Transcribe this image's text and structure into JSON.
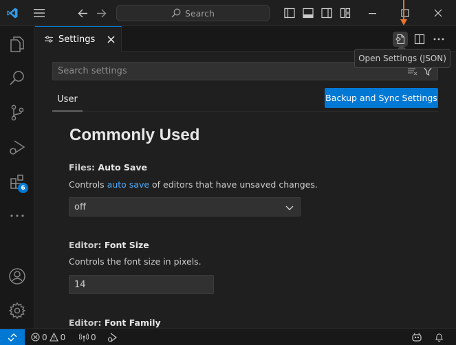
{
  "titlebar": {
    "search_label": "Search"
  },
  "activitybar": {
    "extensions_badge": "6"
  },
  "tabs": [
    {
      "label": "Settings",
      "icon": "settings-sliders-icon"
    }
  ],
  "tooltip": {
    "text": "Open Settings (JSON)"
  },
  "settings": {
    "search_placeholder": "Search settings",
    "scope_tab": "User",
    "sync_button": "Backup and Sync Settings",
    "section_title": "Commonly Used",
    "items": [
      {
        "category": "Files: ",
        "name": "Auto Save",
        "desc_before": "Controls ",
        "desc_link": "auto save",
        "desc_after": " of editors that have unsaved changes.",
        "value": "off"
      },
      {
        "category": "Editor: ",
        "name": "Font Size",
        "desc": "Controls the font size in pixels.",
        "value": "14"
      },
      {
        "category": "Editor: ",
        "name": "Font Family"
      }
    ]
  },
  "statusbar": {
    "errors": "0",
    "warnings": "0",
    "ports": "0"
  },
  "colors": {
    "accent": "#0078d4",
    "link": "#4daafc",
    "annotation_arrow": "#e8742a"
  }
}
